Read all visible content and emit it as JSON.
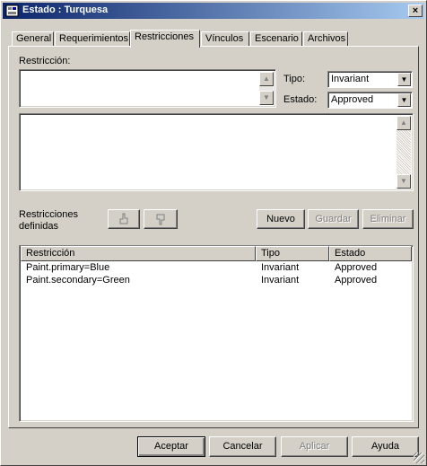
{
  "window": {
    "title": "Estado : Turquesa"
  },
  "tabs": [
    {
      "label": "General"
    },
    {
      "label": "Requerimientos"
    },
    {
      "label": "Restricciones"
    },
    {
      "label": "Vínculos"
    },
    {
      "label": "Escenario"
    },
    {
      "label": "Archivos"
    }
  ],
  "form": {
    "restriccion_label": "Restricción:",
    "restriccion_value": "",
    "tipo_label": "Tipo:",
    "tipo_value": "Invariant",
    "estado_label": "Estado:",
    "estado_value": "Approved",
    "notes_value": ""
  },
  "defined": {
    "label_line1": "Restricciones",
    "label_line2": "definidas",
    "nuevo": "Nuevo",
    "guardar": "Guardar",
    "eliminar": "Eliminar"
  },
  "table": {
    "columns": [
      "Restricción",
      "Tipo",
      "Estado"
    ],
    "rows": [
      [
        "Paint.primary=Blue",
        "Invariant",
        "Approved"
      ],
      [
        "Paint.secondary=Green",
        "Invariant",
        "Approved"
      ]
    ]
  },
  "footer": {
    "aceptar": "Aceptar",
    "cancelar": "Cancelar",
    "aplicar": "Aplicar",
    "ayuda": "Ayuda"
  }
}
